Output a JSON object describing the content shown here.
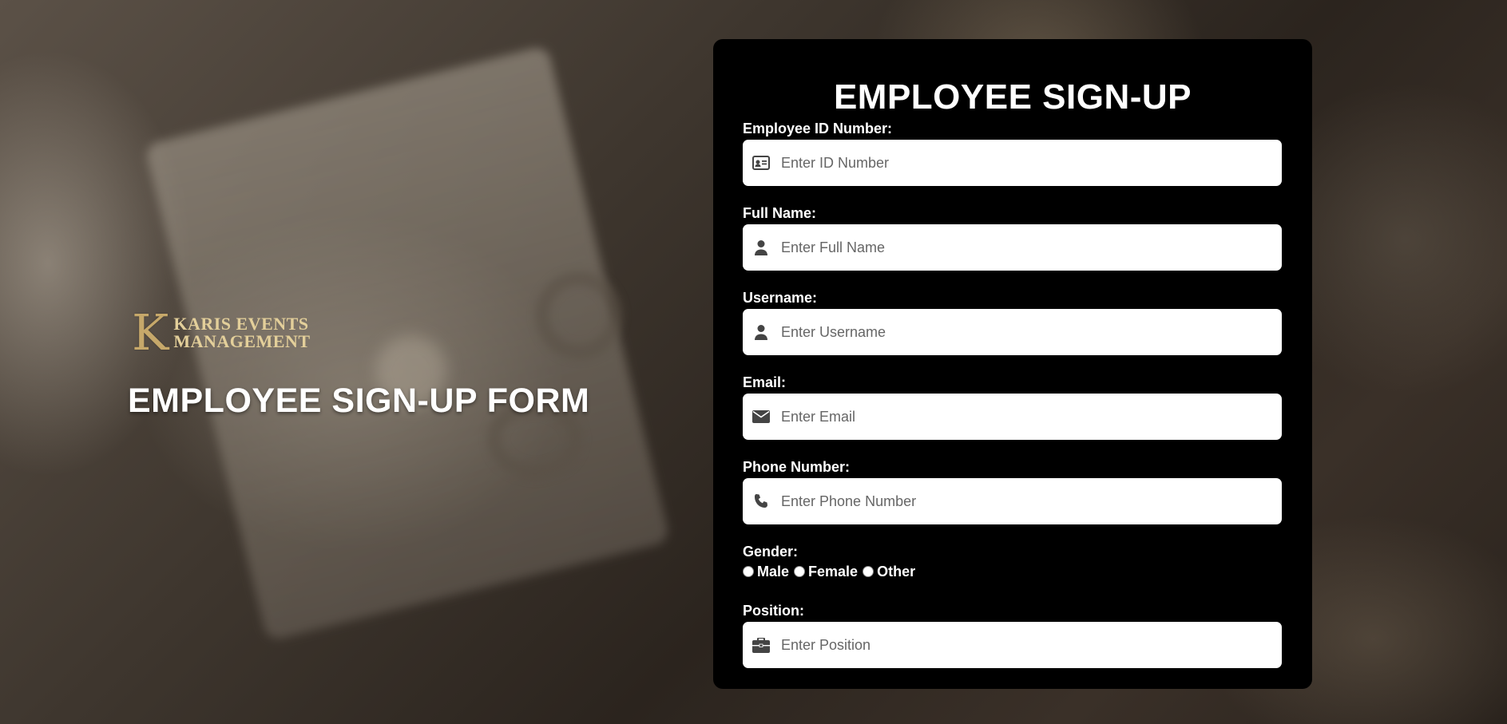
{
  "branding": {
    "logo_letter": "K",
    "logo_line1": "KARIS EVENTS",
    "logo_line2": "MANAGEMENT",
    "page_heading": "EMPLOYEE SIGN-UP FORM"
  },
  "form": {
    "title": "EMPLOYEE SIGN-UP",
    "fields": {
      "employee_id": {
        "label": "Employee ID Number:",
        "placeholder": "Enter ID Number",
        "icon": "id-card-icon"
      },
      "full_name": {
        "label": "Full Name:",
        "placeholder": "Enter Full Name",
        "icon": "user-icon"
      },
      "username": {
        "label": "Username:",
        "placeholder": "Enter Username",
        "icon": "user-icon"
      },
      "email": {
        "label": "Email:",
        "placeholder": "Enter Email",
        "icon": "envelope-icon"
      },
      "phone": {
        "label": "Phone Number:",
        "placeholder": "Enter Phone Number",
        "icon": "phone-icon"
      },
      "position": {
        "label": "Position:",
        "placeholder": "Enter Position",
        "icon": "briefcase-icon"
      }
    },
    "gender": {
      "label": "Gender:",
      "options": [
        "Male",
        "Female",
        "Other"
      ]
    }
  },
  "colors": {
    "panel_bg": "#000000",
    "gold": "#c6a86a",
    "icon": "#444444"
  }
}
